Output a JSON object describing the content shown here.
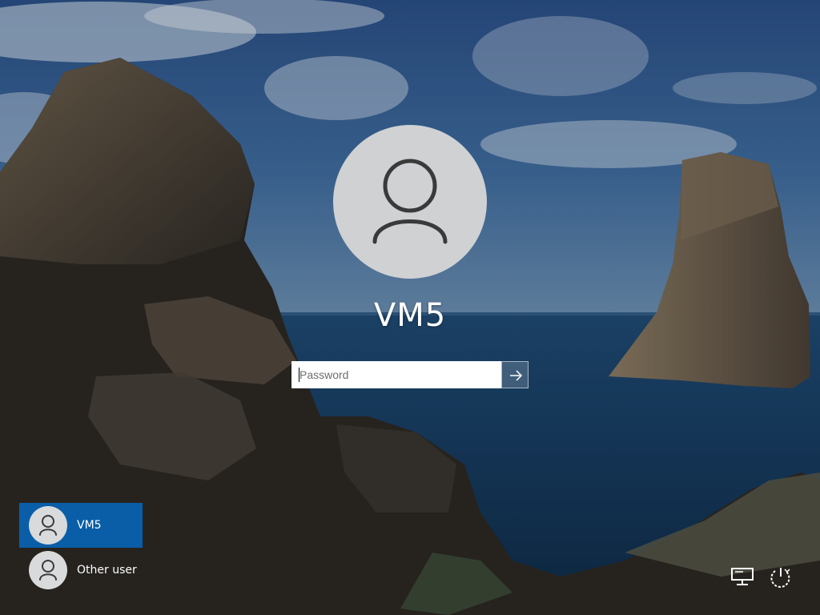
{
  "lock_screen": {
    "username": "VM5",
    "password_placeholder": "Password",
    "submit_icon": "arrow-right-icon"
  },
  "user_list": {
    "items": [
      {
        "label": "VM5",
        "selected": true,
        "icon": "user-icon"
      },
      {
        "label": "Other user",
        "selected": false,
        "icon": "user-icon"
      }
    ]
  },
  "system_tray": {
    "network_icon": "network-icon",
    "power_icon": "power-icon"
  },
  "colors": {
    "selected_user_bg": "#0a5ea8",
    "avatar_bg": "#cfd1d3",
    "text": "#ffffff"
  }
}
